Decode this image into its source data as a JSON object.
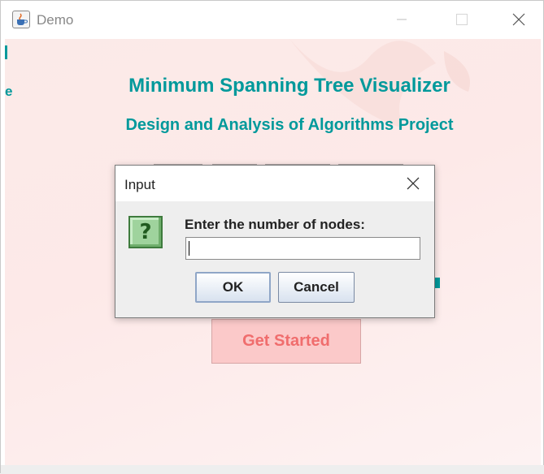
{
  "window": {
    "title": "Demo",
    "icons": [
      "java-cup-icon",
      "minimize-icon",
      "maximize-icon",
      "close-icon"
    ]
  },
  "main": {
    "title": "Minimum Spanning Tree Visualizer",
    "subtitle": "Design and Analysis of Algorithms Project",
    "get_started_label": "Get Started",
    "colors": {
      "accent": "#00999b",
      "button_bg": "#fbc9c9",
      "button_text": "#f06d6d"
    }
  },
  "dialog": {
    "title": "Input",
    "prompt": "Enter the number of nodes:",
    "input_value": "",
    "ok_label": "OK",
    "cancel_label": "Cancel",
    "icon": "question-icon",
    "icon_glyph": "?"
  }
}
